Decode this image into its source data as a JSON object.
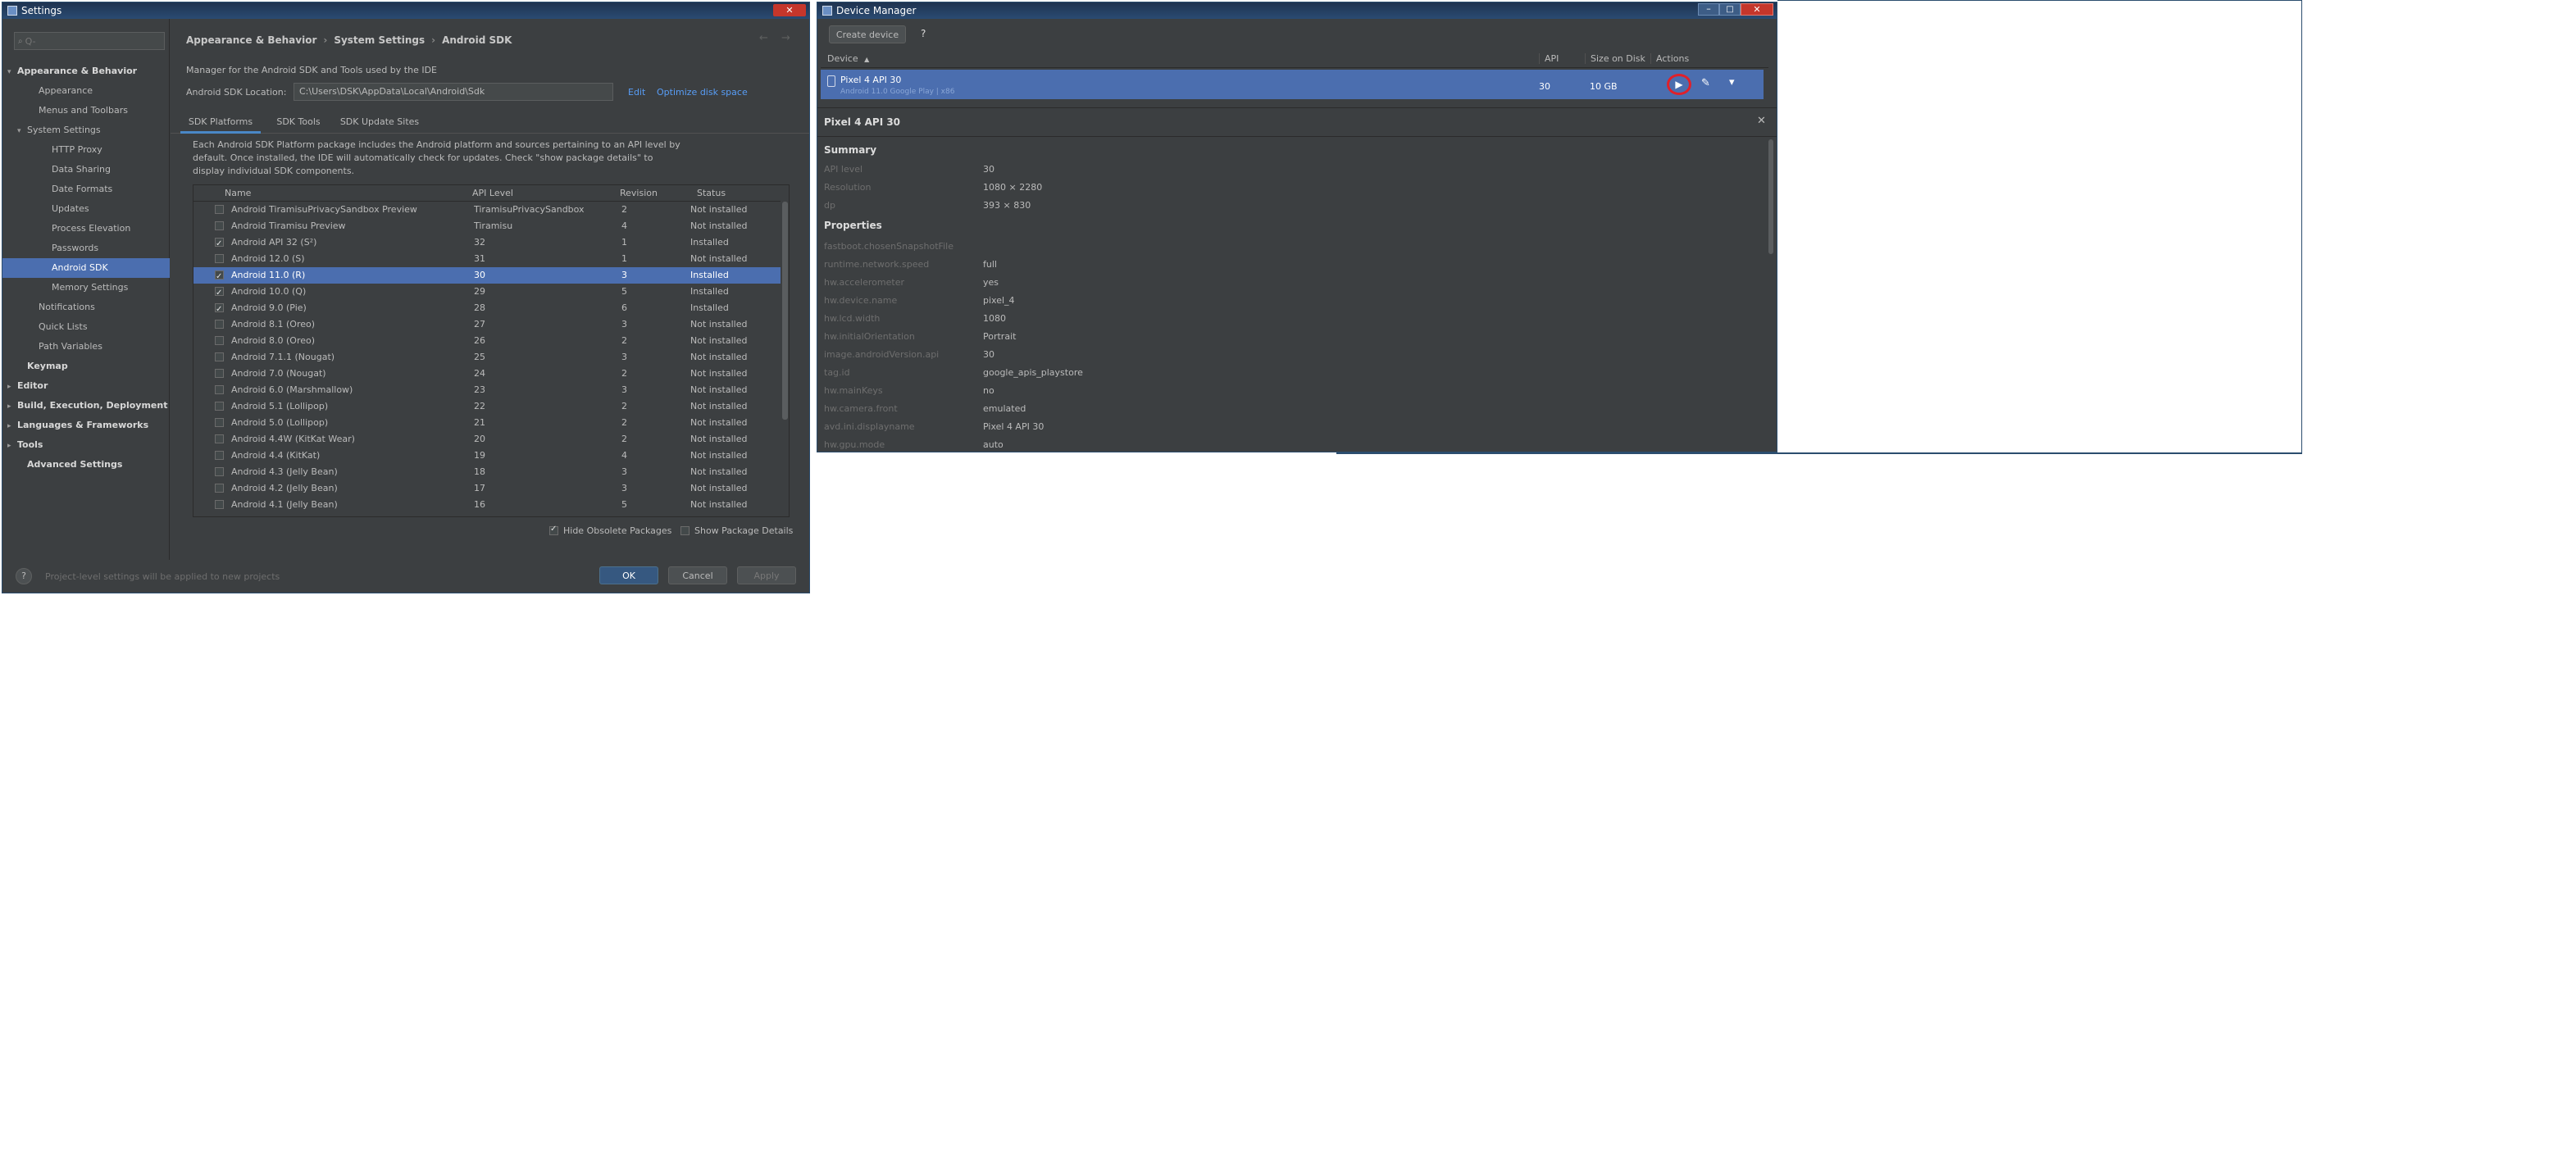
{
  "settings": {
    "title": "Settings",
    "search_placeholder": "Q-",
    "tree": [
      {
        "label": "Appearance & Behavior",
        "bold": true,
        "arrow": "▾"
      },
      {
        "label": "Appearance"
      },
      {
        "label": "Menus and Toolbars"
      },
      {
        "label": "System Settings",
        "arrow": "▾"
      },
      {
        "label": "HTTP Proxy"
      },
      {
        "label": "Data Sharing"
      },
      {
        "label": "Date Formats"
      },
      {
        "label": "Updates"
      },
      {
        "label": "Process Elevation"
      },
      {
        "label": "Passwords"
      },
      {
        "label": "Android SDK",
        "selected": true
      },
      {
        "label": "Memory Settings"
      },
      {
        "label": "Notifications"
      },
      {
        "label": "Quick Lists"
      },
      {
        "label": "Path Variables"
      },
      {
        "label": "Keymap",
        "bold": true
      },
      {
        "label": "Editor",
        "bold": true,
        "arrow": "▸"
      },
      {
        "label": "Build, Execution, Deployment",
        "bold": true,
        "arrow": "▸"
      },
      {
        "label": "Languages & Frameworks",
        "bold": true,
        "arrow": "▸"
      },
      {
        "label": "Tools",
        "bold": true,
        "arrow": "▸"
      },
      {
        "label": "Advanced Settings",
        "bold": true
      }
    ],
    "breadcrumb": [
      "Appearance & Behavior",
      "System Settings",
      "Android SDK"
    ],
    "breadcrumb_sep": "›",
    "nav_back": "←",
    "nav_forward": "→",
    "manager_desc": "Manager for the Android SDK and Tools used by the IDE",
    "sdk_location_label": "Android SDK Location:",
    "sdk_location_value": "C:\\Users\\DSK\\AppData\\Local\\Android\\Sdk",
    "edit_link": "Edit",
    "optimize_link": "Optimize disk space",
    "tabs": [
      "SDK Platforms",
      "SDK Tools",
      "SDK Update Sites"
    ],
    "platform_desc": "Each Android SDK Platform package includes the Android platform and sources pertaining to an API level by default. Once installed, the IDE will automatically check for updates. Check \"show package details\" to display individual SDK components.",
    "columns": [
      "Name",
      "API Level",
      "Revision",
      "Status"
    ],
    "sort_icon": "▲",
    "rows": [
      {
        "name": "Android TiramisuPrivacySandbox Preview",
        "api": "TiramisuPrivacySandbox",
        "rev": "2",
        "status": "Not installed",
        "checked": false
      },
      {
        "name": "Android Tiramisu Preview",
        "api": "Tiramisu",
        "rev": "4",
        "status": "Not installed",
        "checked": false
      },
      {
        "name": "Android API 32 (S²)",
        "api": "32",
        "rev": "1",
        "status": "Installed",
        "checked": true
      },
      {
        "name": "Android 12.0 (S)",
        "api": "31",
        "rev": "1",
        "status": "Not installed",
        "checked": false
      },
      {
        "name": "Android 11.0 (R)",
        "api": "30",
        "rev": "3",
        "status": "Installed",
        "checked": true,
        "selected": true
      },
      {
        "name": "Android 10.0 (Q)",
        "api": "29",
        "rev": "5",
        "status": "Installed",
        "checked": true
      },
      {
        "name": "Android 9.0 (Pie)",
        "api": "28",
        "rev": "6",
        "status": "Installed",
        "checked": true
      },
      {
        "name": "Android 8.1 (Oreo)",
        "api": "27",
        "rev": "3",
        "status": "Not installed",
        "checked": false
      },
      {
        "name": "Android 8.0 (Oreo)",
        "api": "26",
        "rev": "2",
        "status": "Not installed",
        "checked": false
      },
      {
        "name": "Android 7.1.1 (Nougat)",
        "api": "25",
        "rev": "3",
        "status": "Not installed",
        "checked": false
      },
      {
        "name": "Android 7.0 (Nougat)",
        "api": "24",
        "rev": "2",
        "status": "Not installed",
        "checked": false
      },
      {
        "name": "Android 6.0 (Marshmallow)",
        "api": "23",
        "rev": "3",
        "status": "Not installed",
        "checked": false
      },
      {
        "name": "Android 5.1 (Lollipop)",
        "api": "22",
        "rev": "2",
        "status": "Not installed",
        "checked": false
      },
      {
        "name": "Android 5.0 (Lollipop)",
        "api": "21",
        "rev": "2",
        "status": "Not installed",
        "checked": false
      },
      {
        "name": "Android 4.4W (KitKat Wear)",
        "api": "20",
        "rev": "2",
        "status": "Not installed",
        "checked": false
      },
      {
        "name": "Android 4.4 (KitKat)",
        "api": "19",
        "rev": "4",
        "status": "Not installed",
        "checked": false
      },
      {
        "name": "Android 4.3 (Jelly Bean)",
        "api": "18",
        "rev": "3",
        "status": "Not installed",
        "checked": false
      },
      {
        "name": "Android 4.2 (Jelly Bean)",
        "api": "17",
        "rev": "3",
        "status": "Not installed",
        "checked": false
      },
      {
        "name": "Android 4.1 (Jelly Bean)",
        "api": "16",
        "rev": "5",
        "status": "Not installed",
        "checked": false
      }
    ],
    "hide_obsolete": "Hide Obsolete Packages",
    "show_details": "Show Package Details",
    "help_glyph": "?",
    "footer_note": "Project-level settings will be applied to new projects",
    "ok": "OK",
    "cancel": "Cancel",
    "apply": "Apply"
  },
  "device_manager": {
    "title": "Device Manager",
    "create_device": "Create device",
    "help_glyph": "?",
    "columns": [
      "Device",
      "API",
      "Size on Disk",
      "Actions"
    ],
    "sort_icon": "▲",
    "device_name": "Pixel 4 API 30",
    "device_sub": "Android 11.0 Google Play | x86",
    "device_api": "30",
    "device_size": "10 GB",
    "play_icon": "▶",
    "edit_icon": "✎",
    "more_icon": "▾",
    "close_icon": "✕",
    "details_title": "Pixel 4 API 30",
    "summary_heading": "Summary",
    "summary": [
      {
        "k": "API level",
        "v": "30"
      },
      {
        "k": "Resolution",
        "v": "1080 × 2280"
      },
      {
        "k": "dp",
        "v": "393 × 830"
      }
    ],
    "properties_heading": "Properties",
    "properties": [
      {
        "k": "fastboot.chosenSnapshotFile",
        "v": ""
      },
      {
        "k": "runtime.network.speed",
        "v": "full"
      },
      {
        "k": "hw.accelerometer",
        "v": "yes"
      },
      {
        "k": "hw.device.name",
        "v": "pixel_4"
      },
      {
        "k": "hw.lcd.width",
        "v": "1080"
      },
      {
        "k": "hw.initialOrientation",
        "v": "Portrait"
      },
      {
        "k": "image.androidVersion.api",
        "v": "30"
      },
      {
        "k": "tag.id",
        "v": "google_apis_playstore"
      },
      {
        "k": "hw.mainKeys",
        "v": "no"
      },
      {
        "k": "hw.camera.front",
        "v": "emulated"
      },
      {
        "k": "avd.ini.displayname",
        "v": "Pixel 4 API 30"
      },
      {
        "k": "hw.gpu.mode",
        "v": "auto"
      }
    ]
  },
  "colors": {
    "panel": "#3c3f41",
    "sidebar": "#3c3f41",
    "selection": "#4b6eaf",
    "link": "#589df6",
    "highlight_ring": "#e0202a"
  }
}
